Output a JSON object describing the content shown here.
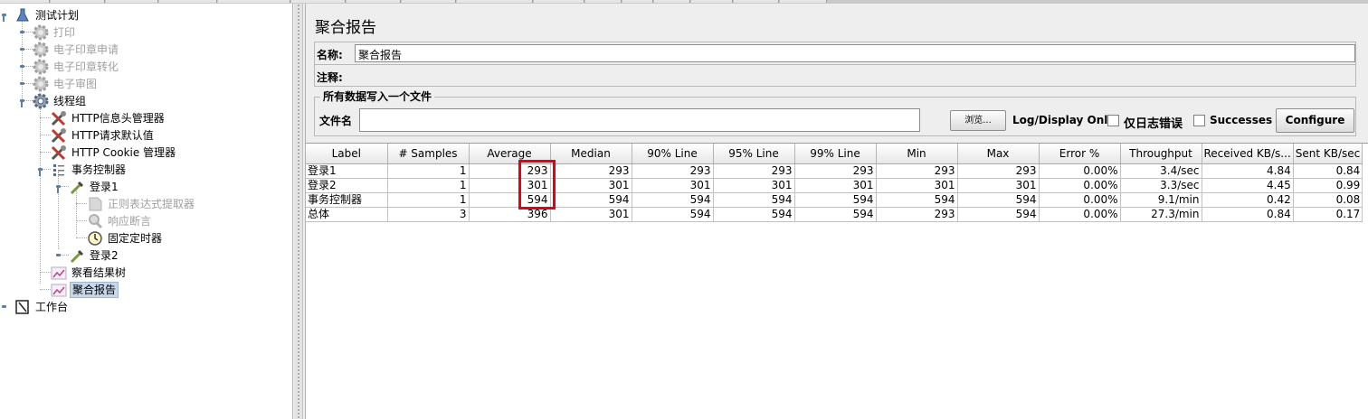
{
  "tree": {
    "items": [
      {
        "label": "测试计划",
        "icon": "test-plan-flask-icon"
      },
      {
        "label": "打印",
        "icon": "gear-icon",
        "disabled": true
      },
      {
        "label": "电子印章申请",
        "icon": "gear-icon",
        "disabled": true
      },
      {
        "label": "电子印章转化",
        "icon": "gear-icon",
        "disabled": true
      },
      {
        "label": "电子审图",
        "icon": "gear-icon",
        "disabled": true
      },
      {
        "label": "线程组",
        "icon": "gear-icon"
      },
      {
        "label": "HTTP信息头管理器",
        "icon": "wrench-icon"
      },
      {
        "label": "HTTP请求默认值",
        "icon": "wrench-icon"
      },
      {
        "label": "HTTP Cookie 管理器",
        "icon": "wrench-icon"
      },
      {
        "label": "事务控制器",
        "icon": "controller-icon"
      },
      {
        "label": "登录1",
        "icon": "sampler-pipette-icon"
      },
      {
        "label": "正则表达式提取器",
        "icon": "extractor-icon",
        "disabled": true
      },
      {
        "label": "响应断言",
        "icon": "assertion-magnifier-icon",
        "disabled": true
      },
      {
        "label": "固定定时器",
        "icon": "timer-clock-icon"
      },
      {
        "label": "登录2",
        "icon": "sampler-pipette-icon"
      },
      {
        "label": "察看结果树",
        "icon": "listener-graph-icon"
      },
      {
        "label": "聚合报告",
        "icon": "listener-graph-icon",
        "selected": true
      },
      {
        "label": "工作台",
        "icon": "workbench-icon"
      }
    ]
  },
  "panel": {
    "title": "聚合报告",
    "name_label": "名称:",
    "name_value": "聚合报告",
    "comment_label": "注释:",
    "comment_value": "",
    "file_group_title": "所有数据写入一个文件",
    "filename_label": "文件名",
    "filename_value": "",
    "browse_label": "浏览...",
    "log_display_label": "Log/Display Only:",
    "errors_only_label": "仅日志错误",
    "successes_label": "Successes",
    "configure_label": "Configure"
  },
  "table": {
    "headers": [
      "Label",
      "# Samples",
      "Average",
      "Median",
      "90% Line",
      "95% Line",
      "99% Line",
      "Min",
      "Max",
      "Error %",
      "Throughput",
      "Received KB/s...",
      "Sent KB/sec"
    ],
    "rows": [
      [
        "登录1",
        "1",
        "293",
        "293",
        "293",
        "293",
        "293",
        "293",
        "293",
        "0.00%",
        "3.4/sec",
        "4.84",
        "0.84"
      ],
      [
        "登录2",
        "1",
        "301",
        "301",
        "301",
        "301",
        "301",
        "301",
        "301",
        "0.00%",
        "3.3/sec",
        "4.45",
        "0.99"
      ],
      [
        "事务控制器",
        "1",
        "594",
        "594",
        "594",
        "594",
        "594",
        "594",
        "594",
        "0.00%",
        "9.1/min",
        "0.42",
        "0.08"
      ],
      [
        "总体",
        "3",
        "396",
        "301",
        "594",
        "594",
        "594",
        "293",
        "594",
        "0.00%",
        "27.3/min",
        "0.84",
        "0.17"
      ]
    ]
  },
  "colors": {
    "highlight": "#e60012",
    "selection": "#c7d8ea"
  }
}
